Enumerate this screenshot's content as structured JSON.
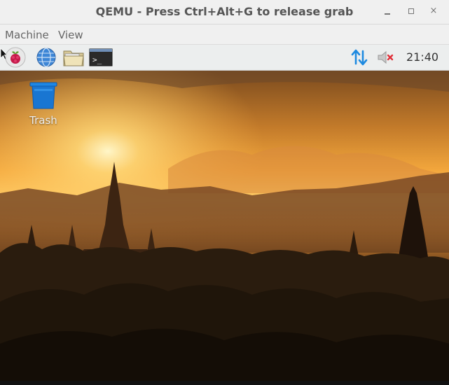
{
  "window": {
    "title": "QEMU - Press Ctrl+Alt+G to release grab",
    "close_glyph": "×"
  },
  "menubar": {
    "items": [
      {
        "label": "Machine"
      },
      {
        "label": "View"
      }
    ]
  },
  "panel": {
    "launchers": [
      "raspberry-pi-menu-icon",
      "web-browser-icon",
      "file-manager-icon",
      "terminal-icon"
    ],
    "terminal_glyph": ">_",
    "network_icon": "network-arrows-icon",
    "volume_icon": "volume-muted-icon",
    "clock": "21:40",
    "colors": {
      "network": "#1e8ae0",
      "mute_x": "#e0303a"
    }
  },
  "desktop": {
    "icons": [
      {
        "label": "Trash",
        "icon": "trash-icon",
        "color": "#1976d2"
      }
    ],
    "wallpaper": "sunset-over-temples"
  }
}
